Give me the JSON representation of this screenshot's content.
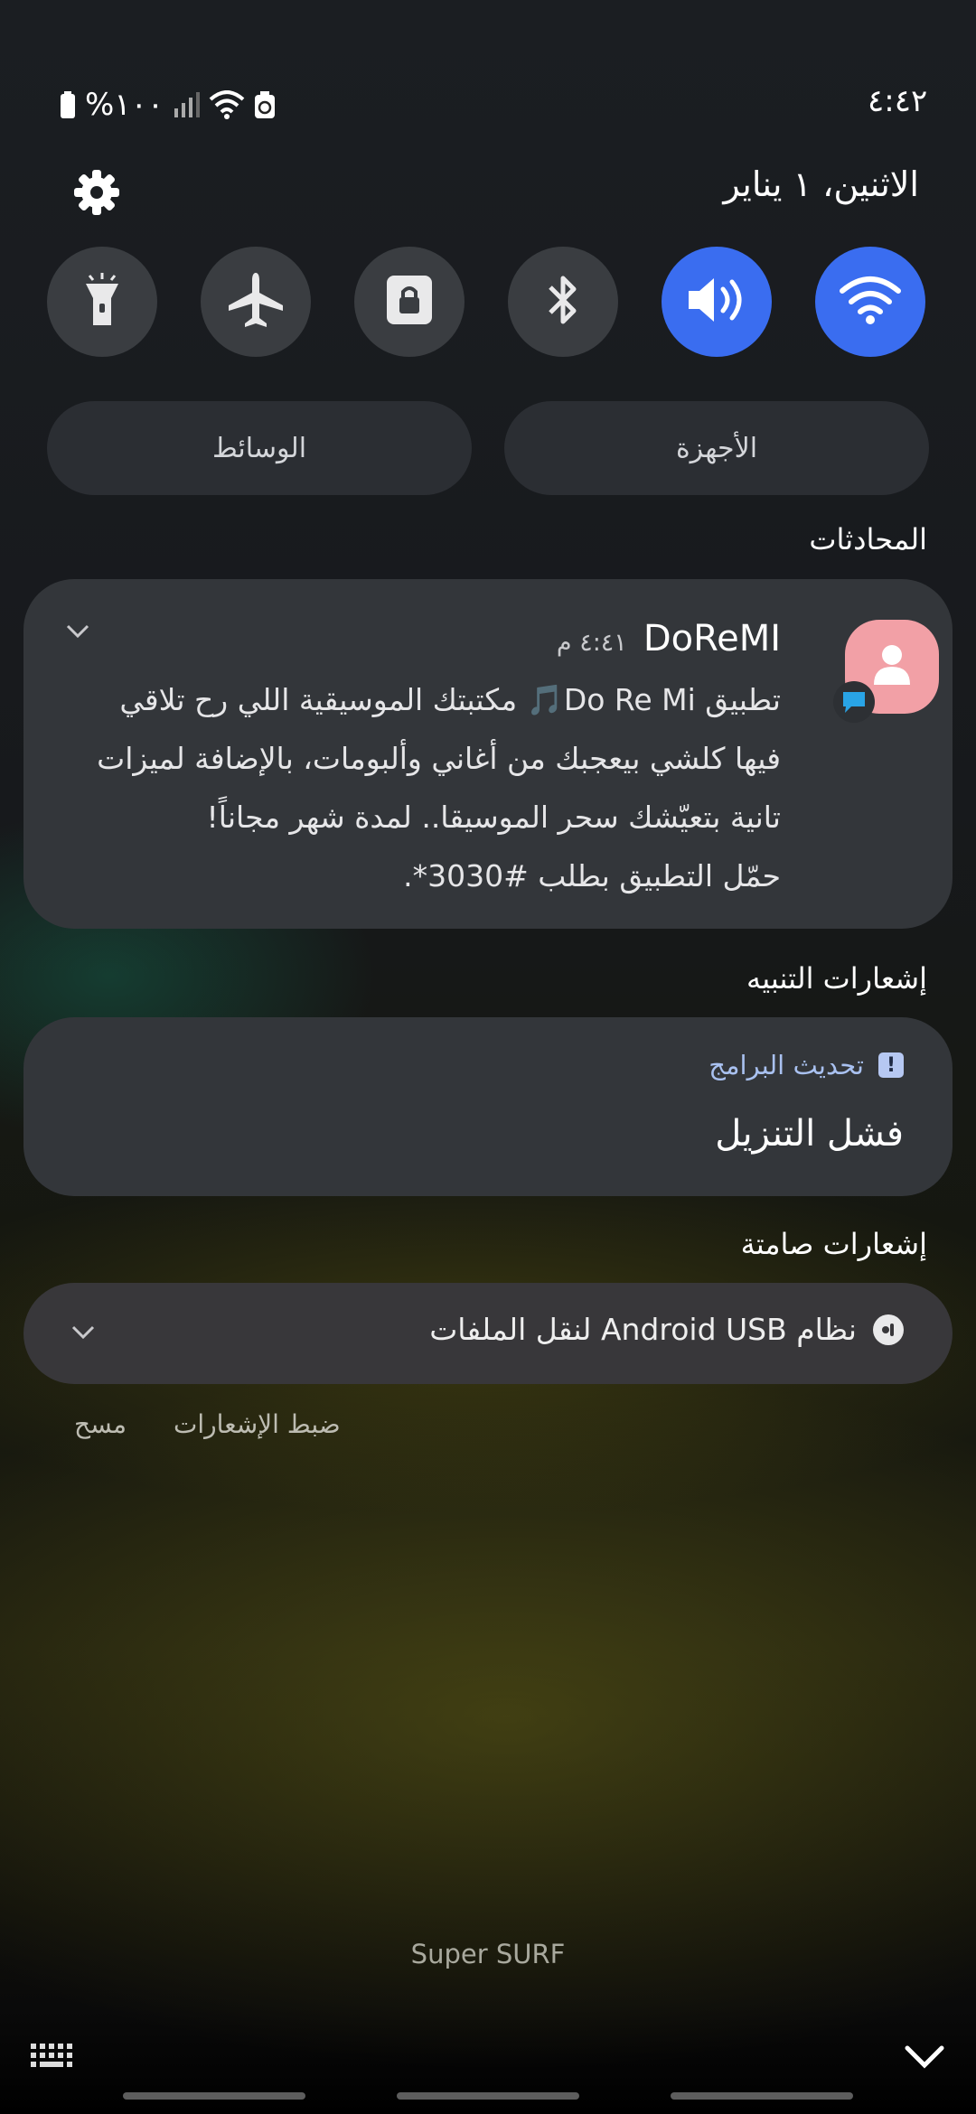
{
  "status_bar": {
    "time": "٤:٤٢",
    "battery": "%١٠٠",
    "icons": [
      "battery-icon",
      "signal-icon",
      "wifi-icon",
      "recycle-icon"
    ]
  },
  "header": {
    "date": "الاثنين، ١ يناير",
    "settings_icon": "gear-icon"
  },
  "quick_settings": {
    "toggles": [
      {
        "name": "flashlight",
        "icon": "flashlight-icon",
        "on": false
      },
      {
        "name": "airplane-mode",
        "icon": "airplane-icon",
        "on": false
      },
      {
        "name": "rotation-lock",
        "icon": "lock-icon",
        "on": false
      },
      {
        "name": "bluetooth",
        "icon": "bluetooth-icon",
        "on": false
      },
      {
        "name": "sound",
        "icon": "volume-icon",
        "on": true
      },
      {
        "name": "wifi",
        "icon": "wifi-icon",
        "on": true
      }
    ],
    "media_label": "الوسائط",
    "devices_label": "الأجهزة",
    "accent_color": "#3a6df0"
  },
  "conversations": {
    "section_title": "المحادثات",
    "sender": "DoReMI",
    "time": "٤:٤١ م",
    "body_lines": [
      "تطبيق Do Re Mi🎵 مكتبتك الموسيقية اللي رح تلاقي",
      "فيها كلشي بيعجبك من أغاني وألبومات، بالإضافة لميزات",
      "تانية بتعيّشك سحر الموسيقا.. لمدة شهر مجاناً!",
      "حمّل التطبيق بطلب #3030*."
    ]
  },
  "alerts": {
    "section_title": "إشعارات التنبيه",
    "app_name": "تحديث البرامج",
    "title": "فشل التنزيل"
  },
  "silent": {
    "section_title": "إشعارات صامتة",
    "text": "نظام Android  USB لنقل الملفات"
  },
  "actions": {
    "notification_settings": "ضبط الإشعارات",
    "clear": "مسح"
  },
  "carrier": "Super SURF"
}
